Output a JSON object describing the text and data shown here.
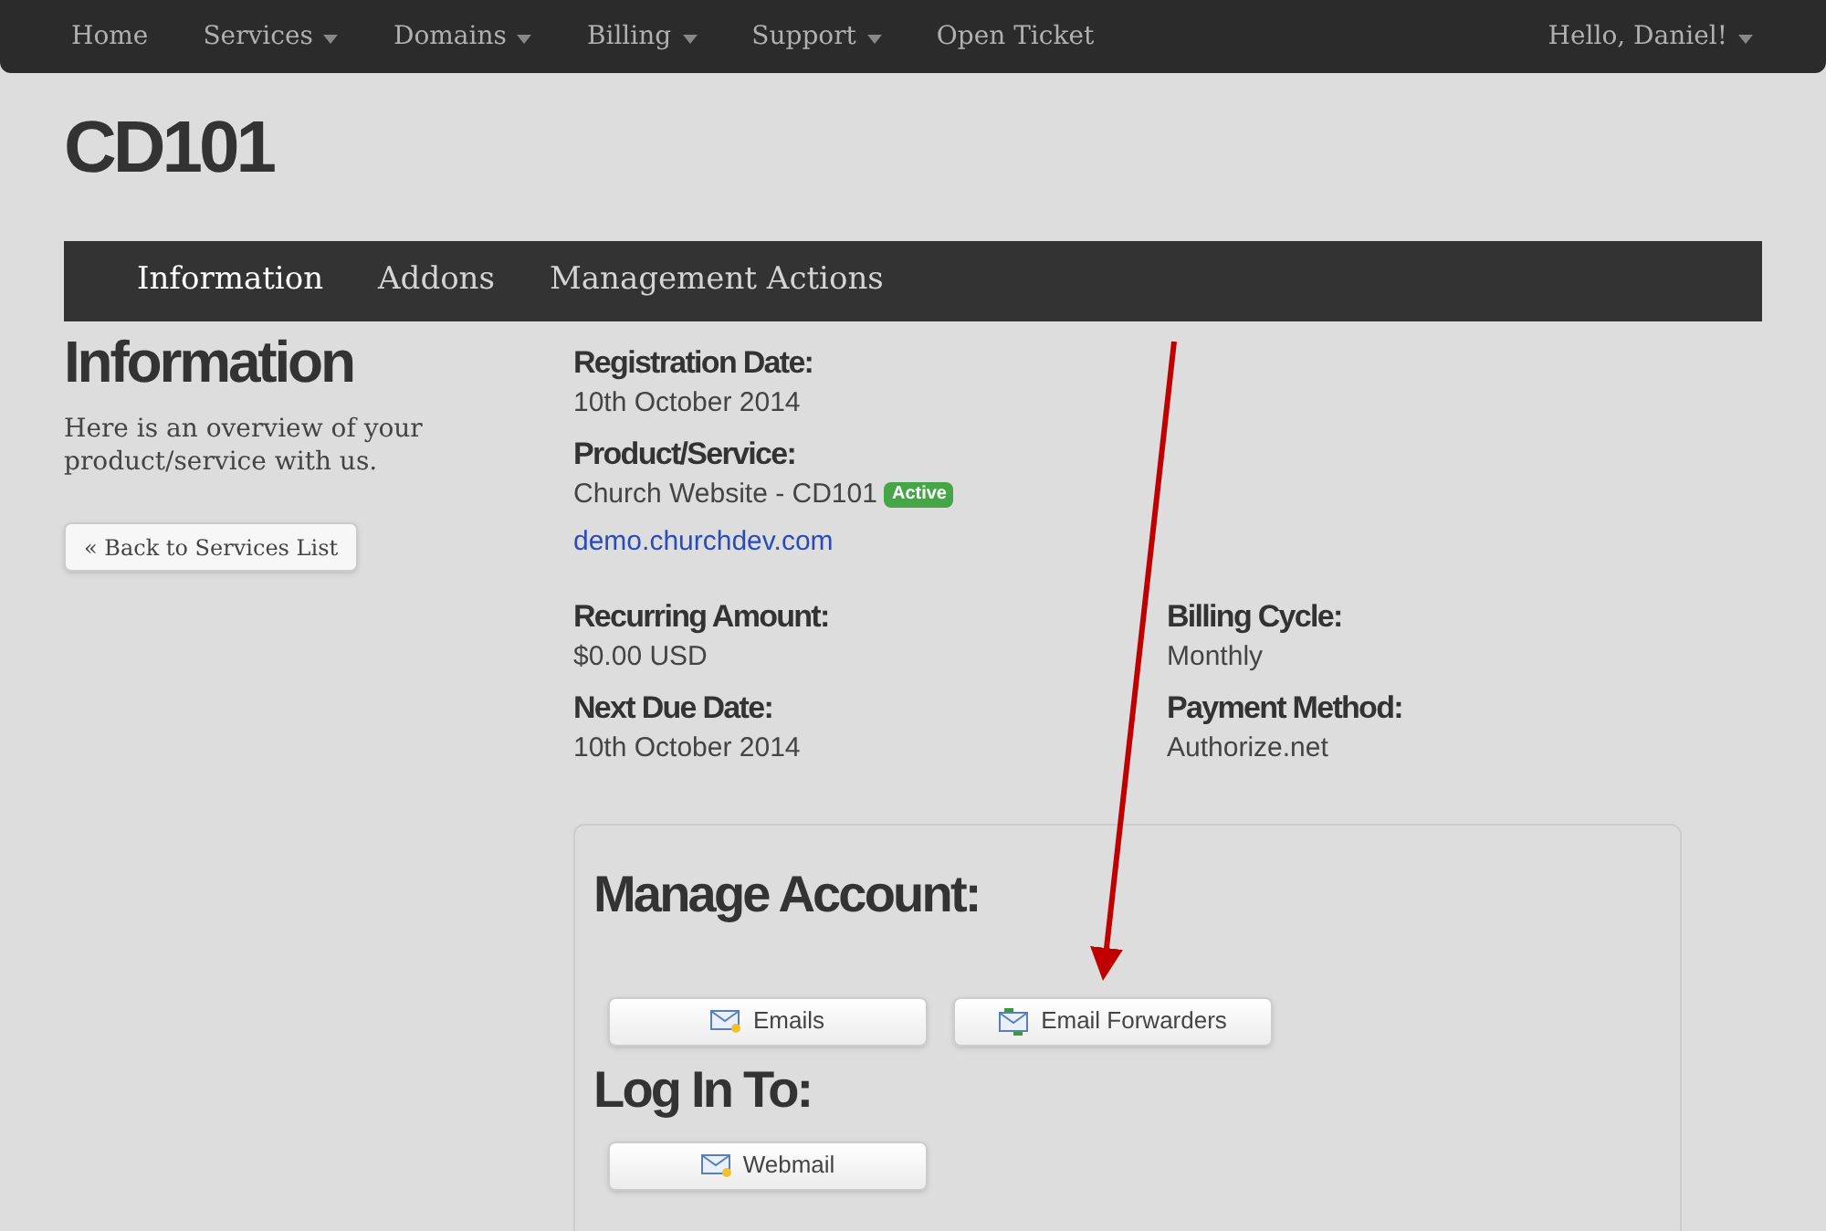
{
  "topnav": {
    "items": [
      {
        "label": "Home",
        "kind": "link"
      },
      {
        "label": "Services",
        "kind": "dropdown"
      },
      {
        "label": "Domains",
        "kind": "dropdown"
      },
      {
        "label": "Billing",
        "kind": "dropdown"
      },
      {
        "label": "Support",
        "kind": "dropdown"
      },
      {
        "label": "Open Ticket",
        "kind": "link"
      }
    ],
    "user": {
      "label": "Hello, Daniel!",
      "kind": "dropdown"
    }
  },
  "page_title": "CD101",
  "tabs": [
    {
      "label": "Information",
      "selected": true
    },
    {
      "label": "Addons",
      "selected": false
    },
    {
      "label": "Management Actions",
      "selected": false
    }
  ],
  "sidebar": {
    "heading": "Information",
    "text": "Here is an overview of your product/service with us.",
    "back_button": "« Back to Services List"
  },
  "details": [
    [
      {
        "label": "Registration Date:",
        "value": "10th October 2014"
      }
    ],
    [
      {
        "label": "Product/Service:",
        "value": "Church Website - CD101",
        "badge": {
          "text": "Active",
          "color": "#46a546"
        },
        "link": "demo.churchdev.com"
      }
    ],
    [
      {
        "label": "Recurring Amount:",
        "value": "$0.00 USD"
      },
      {
        "label": "Billing Cycle:",
        "value": "Monthly"
      }
    ],
    [
      {
        "label": "Next Due Date:",
        "value": "10th October 2014"
      },
      {
        "label": "Payment Method:",
        "value": "Authorize.net"
      }
    ]
  ],
  "panel": {
    "sections": [
      {
        "heading": "Manage Account:",
        "buttons": [
          {
            "label": "Emails",
            "kind": "envelope"
          },
          {
            "label": "Email Forwarders",
            "kind": "forward"
          }
        ]
      },
      {
        "heading": "Log In To:",
        "buttons": [
          {
            "label": "Webmail",
            "kind": "envelope"
          }
        ]
      }
    ]
  }
}
